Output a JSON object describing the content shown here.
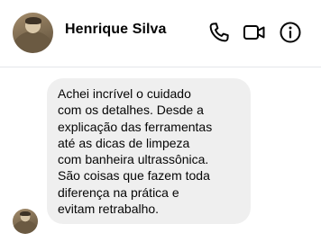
{
  "contact": {
    "name": "Henrique Silva"
  },
  "header": {
    "icons": [
      "phone-icon",
      "video-icon",
      "info-icon"
    ]
  },
  "messages": [
    {
      "text": "Achei incrível o cuidado\ncom os detalhes. Desde a\nexplicação das ferramentas\naté as dicas de limpeza\ncom banheira ultrassônica.\nSão coisas que fazem toda\ndiferença na prática e\nevitam retrabalho."
    }
  ],
  "colors": {
    "bubble": "#efefef",
    "text": "#050505",
    "divider": "#e4e6eb"
  }
}
